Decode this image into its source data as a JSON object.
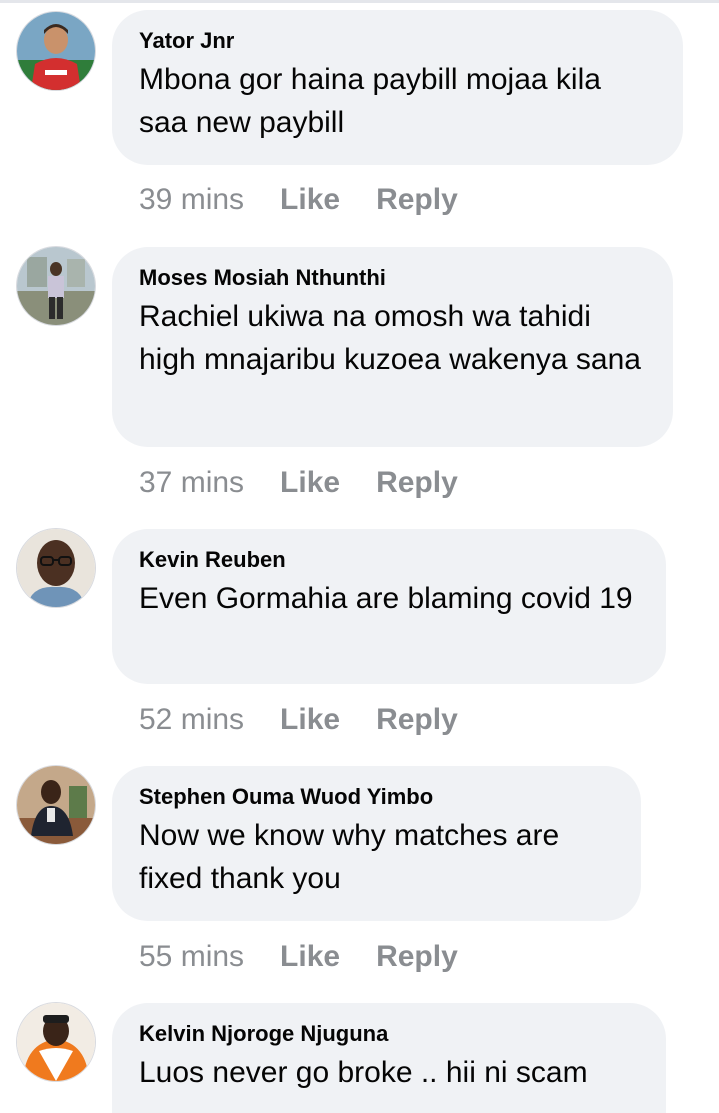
{
  "comments": [
    {
      "author": "Yator Jnr",
      "text": "Mbona gor haina paybill mojaa kila saa new paybill",
      "time": "39 mins",
      "like_label": "Like",
      "reply_label": "Reply",
      "avatar_icon": "profile-photo-man-in-red-jersey"
    },
    {
      "author": "Moses Mosiah Nthunthi",
      "text": "Rachiel ukiwa na omosh wa tahidi high mnajaribu kuzoea wakenya sana",
      "time": "37 mins",
      "like_label": "Like",
      "reply_label": "Reply",
      "avatar_icon": "profile-photo-man-standing-outdoors"
    },
    {
      "author": "Kevin Reuben",
      "text": "Even Gormahia are blaming covid 19",
      "time": "52 mins",
      "like_label": "Like",
      "reply_label": "Reply",
      "avatar_icon": "profile-photo-man-with-glasses"
    },
    {
      "author": "Stephen Ouma Wuod Yimbo",
      "text": "Now we know why matches are fixed thank you",
      "time": "55 mins",
      "like_label": "Like",
      "reply_label": "Reply",
      "avatar_icon": "profile-photo-man-seated-in-office"
    },
    {
      "author": "Kelvin Njoroge Njuguna",
      "text": "Luos never go broke .. hii ni scam",
      "avatar_icon": "profile-photo-man-in-orange-jacket"
    }
  ]
}
